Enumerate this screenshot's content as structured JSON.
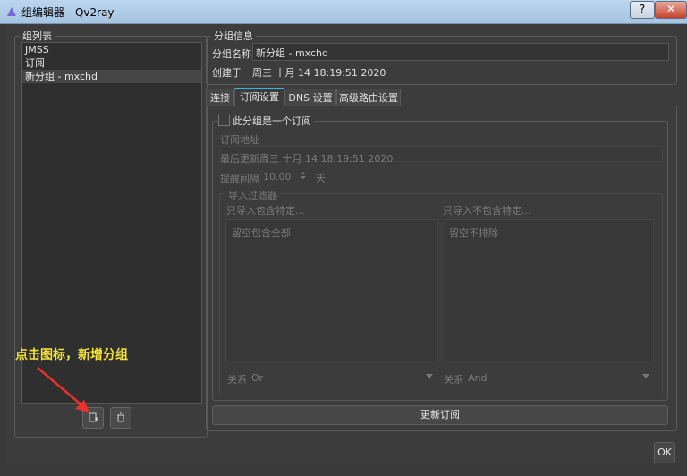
{
  "window": {
    "title": "组编辑器 - Qv2ray",
    "help": "?",
    "close": "✕"
  },
  "group_list": {
    "title": "组列表",
    "items": [
      "JMSS",
      "订阅",
      "新分组 - mxchd"
    ],
    "selected_index": 2
  },
  "group_info": {
    "title": "分组信息",
    "name_label": "分组名称",
    "name_value": "新分组 - mxchd",
    "created_label": "创建于",
    "created_value": "周三 十月 14 18:19:51 2020"
  },
  "tabs": [
    "连接",
    "订阅设置",
    "DNS 设置",
    "高级路由设置"
  ],
  "active_tab": 1,
  "subscription": {
    "checkbox_label": "此分组是一个订阅",
    "url_label": "订阅地址",
    "last_update_label": "最后更新",
    "last_update_value": "周三 十月 14 18:19:51 2020",
    "interval_label": "提醒间隔",
    "interval_value": "10.00",
    "interval_unit": "天",
    "filter_title": "导入过滤器",
    "include_label": "只导入包含特定...",
    "exclude_label": "只导入不包含特定...",
    "include_placeholder": "留空包含全部",
    "exclude_placeholder": "留空不排除",
    "relation_label": "关系",
    "include_relation": "Or",
    "exclude_relation": "And",
    "update_button": "更新订阅"
  },
  "ok_button": "OK",
  "annotation": "点击图标，新增分组",
  "colors": {
    "accent": "#39b8d4",
    "annotation": "#f3e23a",
    "arrow": "#e8322b"
  }
}
